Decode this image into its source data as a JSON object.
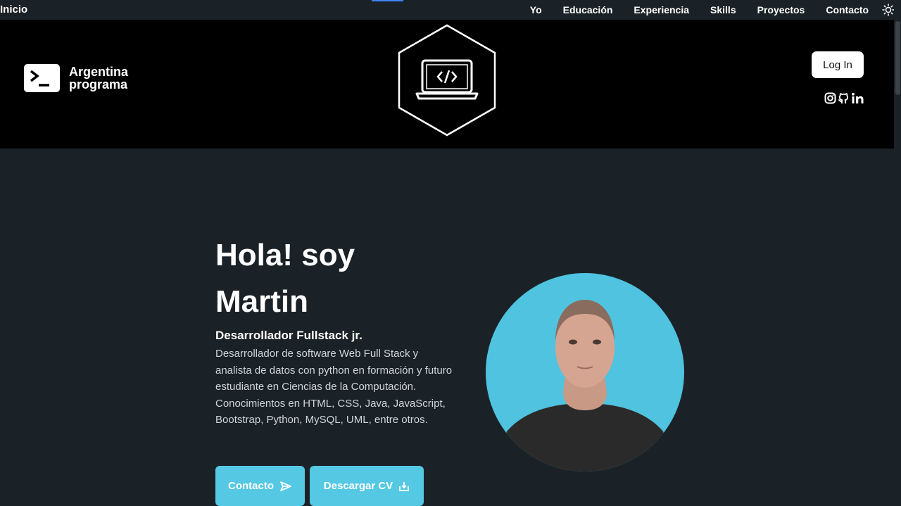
{
  "nav": {
    "brand": "Inicio",
    "links": [
      "Yo",
      "Educación",
      "Experiencia",
      "Skills",
      "Proyectos",
      "Contacto"
    ],
    "theme_icon": "sun-icon"
  },
  "header": {
    "logo_line1": "Argentina",
    "logo_line2": "programa",
    "center_icon": "laptop-code-icon",
    "login_label": "Log In",
    "social_icons": [
      "instagram-icon",
      "github-icon",
      "linkedin-icon"
    ]
  },
  "hero": {
    "title": "Hola! soy Martin",
    "subtitle": "Desarrollador Fullstack jr.",
    "description": "Desarrollador de software Web Full Stack y analista de datos con python en formación y futuro estudiante en Ciencias de la Computación. Conocimientos en HTML, CSS, Java, JavaScript, Bootstrap, Python, MySQL, UML, entre otros.",
    "contact_label": "Contacto",
    "cv_label": "Descargar CV"
  },
  "colors": {
    "background": "#1b2227",
    "accent": "#55c8e3",
    "banner": "#000000"
  }
}
